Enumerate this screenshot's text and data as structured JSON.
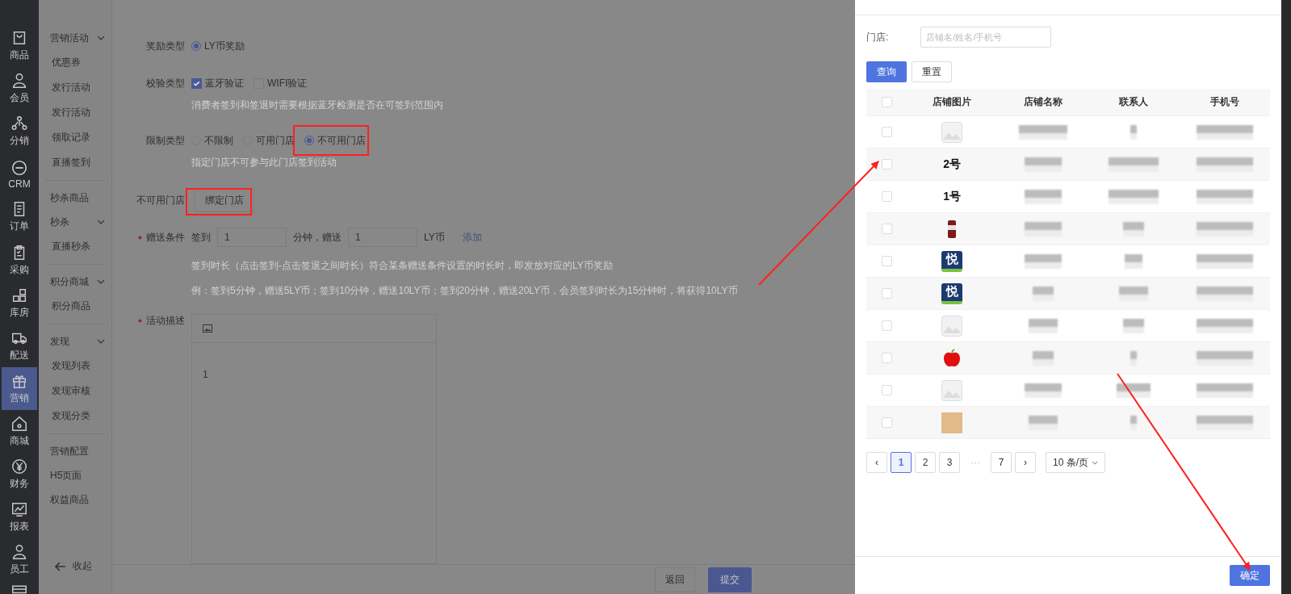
{
  "nav_rail": [
    {
      "label": "商品",
      "selected": false
    },
    {
      "label": "会员",
      "selected": false
    },
    {
      "label": "分销",
      "selected": false
    },
    {
      "label": "CRM",
      "selected": false
    },
    {
      "label": "订单",
      "selected": false
    },
    {
      "label": "采购",
      "selected": false
    },
    {
      "label": "库房",
      "selected": false
    },
    {
      "label": "配送",
      "selected": false
    },
    {
      "label": "营销",
      "selected": true
    },
    {
      "label": "商城",
      "selected": false
    },
    {
      "label": "财务",
      "selected": false
    },
    {
      "label": "报表",
      "selected": false
    },
    {
      "label": "员工",
      "selected": false
    }
  ],
  "sub_menu": {
    "groups": [
      [
        {
          "label": "营销活动",
          "expanded": true,
          "children": [
            "优惠券",
            "发行活动",
            "发行活动",
            "领取记录",
            "直播签到"
          ]
        }
      ],
      [
        {
          "label": "秒杀商品"
        },
        {
          "label": "秒杀",
          "expanded": true,
          "children": [
            "直播秒杀"
          ]
        }
      ],
      [
        {
          "label": "积分商城",
          "expanded": true,
          "children": [
            "积分商品"
          ]
        }
      ],
      [
        {
          "label": "发现",
          "expanded": true,
          "children": [
            "发现列表",
            "发现审核",
            "发现分类"
          ]
        }
      ],
      [
        {
          "label": "营销配置"
        },
        {
          "label": "H5页面"
        },
        {
          "label": "权益商品"
        }
      ]
    ],
    "collapse": "收起"
  },
  "form": {
    "reward_type": {
      "label": "奖励类型",
      "options": [
        {
          "label": "LY币奖励",
          "selected": true
        }
      ]
    },
    "check_type": {
      "label": "校验类型",
      "options": [
        {
          "label": "蓝牙验证",
          "checked": true
        },
        {
          "label": "WIFI验证",
          "checked": false
        }
      ],
      "hint": "消费者签到和签退时需要根据蓝牙检测是否在可签到范围内"
    },
    "limit_type": {
      "label": "限制类型",
      "options": [
        {
          "label": "不限制",
          "selected": false
        },
        {
          "label": "可用门店",
          "selected": false
        },
        {
          "label": "不可用门店",
          "selected": true
        }
      ],
      "hint": "指定门店不可参与此门店签到活动"
    },
    "stores": {
      "label": "不可用门店",
      "button": "绑定门店"
    },
    "gift": {
      "label": "赠送条件",
      "required": true,
      "prefix": "签到",
      "minutes": "1",
      "middle": "分钟，赠送",
      "coins": "1",
      "unit": "LY币",
      "add": "添加",
      "hints": [
        "签到时长（点击签到-点击签退之间时长）符合某条赠送条件设置的时长时，即发放对应的LY币奖励",
        "例：签到5分钟，赠送5LY币；签到10分钟，赠送10LY币；签到20分钟，赠送20LY币，会员签到时长为15分钟时，将获得10LY币"
      ]
    },
    "description": {
      "label": "活动描述",
      "required": true,
      "content": "1"
    },
    "buttons": [
      "返回",
      "提交"
    ]
  },
  "drawer": {
    "filter_label": "门店:",
    "filter_placeholder": "店铺名/姓名/手机号",
    "search": "查询",
    "reset": "重置",
    "select_all_checked": false,
    "columns": [
      "店铺图片",
      "店铺名称",
      "联系人",
      "手机号"
    ],
    "rows": [
      {
        "image": {
          "kind": "placeholder"
        },
        "checked": false
      },
      {
        "image": {
          "kind": "text",
          "text": "2号"
        },
        "checked": false
      },
      {
        "image": {
          "kind": "text",
          "text": "1号"
        },
        "checked": false
      },
      {
        "image": {
          "kind": "can"
        },
        "checked": false
      },
      {
        "image": {
          "kind": "logo",
          "text": "悦"
        },
        "checked": false
      },
      {
        "image": {
          "kind": "logo",
          "text": "悦"
        },
        "checked": false
      },
      {
        "image": {
          "kind": "placeholder"
        },
        "checked": false
      },
      {
        "image": {
          "kind": "apple"
        },
        "checked": false
      },
      {
        "image": {
          "kind": "placeholder"
        },
        "checked": false
      },
      {
        "image": {
          "kind": "photo"
        },
        "checked": false
      }
    ],
    "pagination": {
      "prev": "‹",
      "pages": [
        {
          "label": "1",
          "selected": true
        },
        {
          "label": "2",
          "selected": false
        },
        {
          "label": "3",
          "selected": false
        },
        {
          "label": "···",
          "kind": "ellipsis"
        },
        {
          "label": "7",
          "selected": false
        }
      ],
      "next": "›",
      "page_size": "10 条/页"
    },
    "confirm": "确定"
  }
}
